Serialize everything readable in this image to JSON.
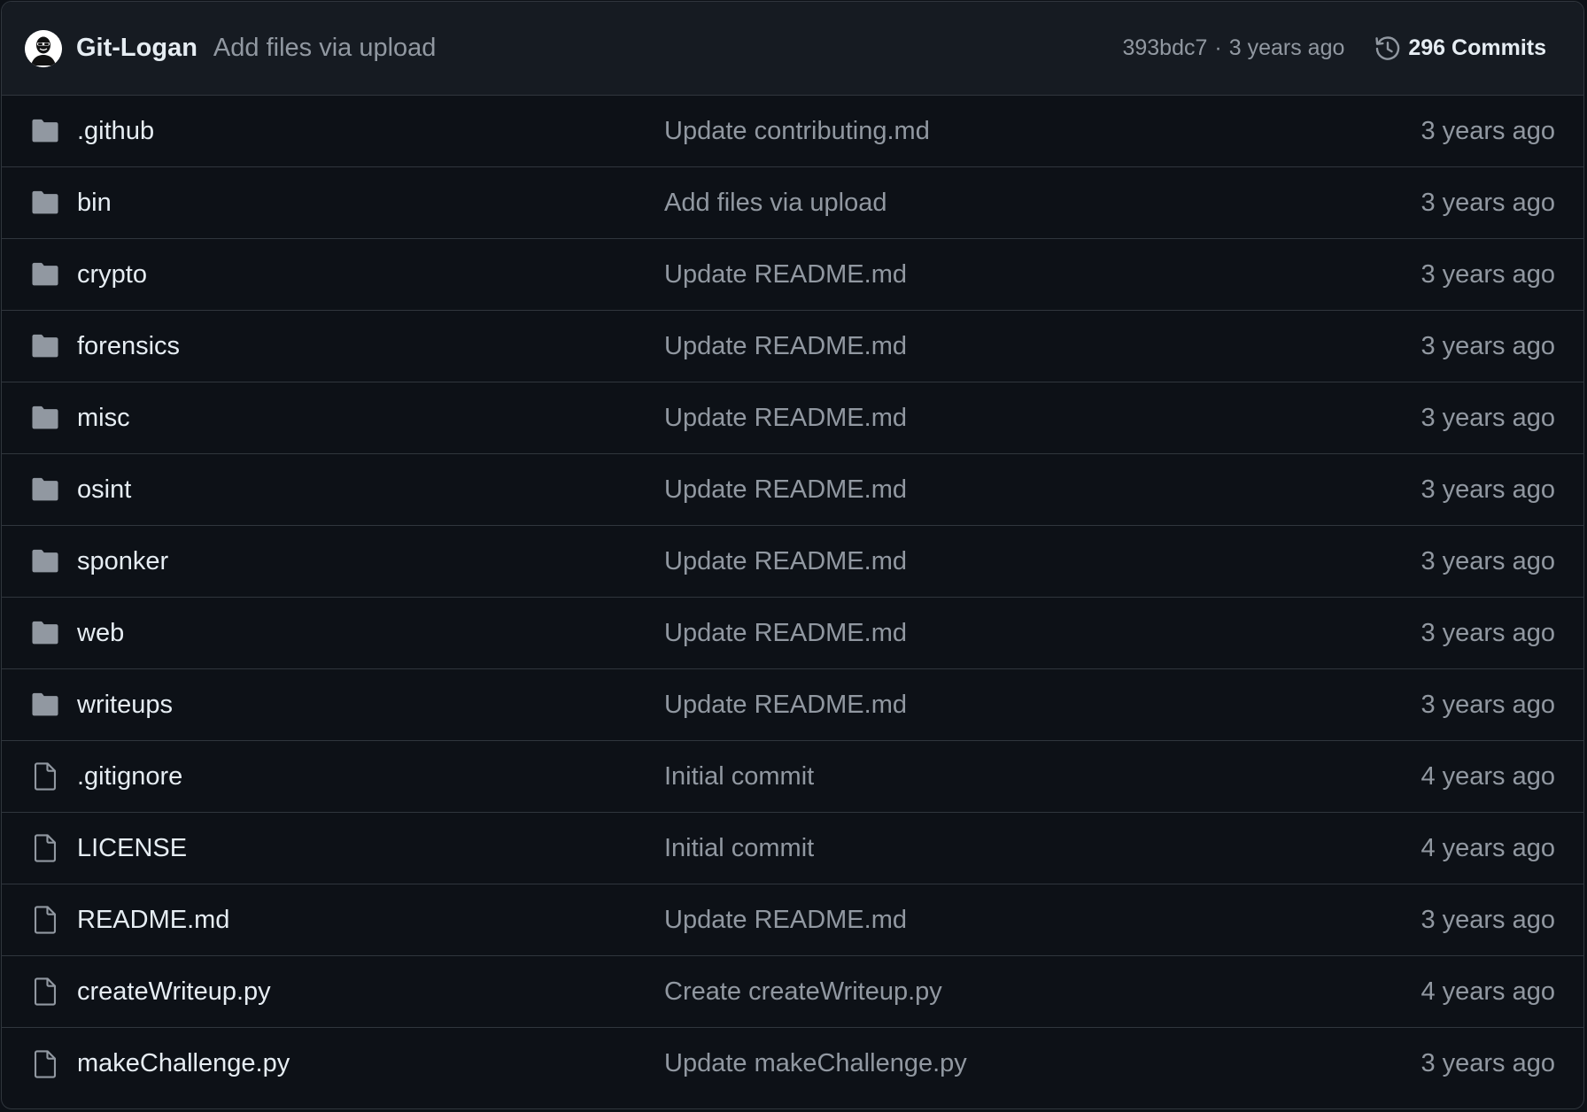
{
  "header": {
    "author": "Git-Logan",
    "commit_message": "Add files via upload",
    "sha": "393bdc7",
    "separator": "·",
    "time": "3 years ago",
    "commits_label": "296 Commits"
  },
  "colors": {
    "background": "#0d1117",
    "header_background": "#161b22",
    "border": "#30363d",
    "text_primary": "#e6edf3",
    "text_muted": "#9198a1",
    "icon": "#9198a1"
  },
  "entries": [
    {
      "type": "folder",
      "icon": "folder-icon",
      "name": ".github",
      "message": "Update contributing.md",
      "age": "3 years ago"
    },
    {
      "type": "folder",
      "icon": "folder-icon",
      "name": "bin",
      "message": "Add files via upload",
      "age": "3 years ago"
    },
    {
      "type": "folder",
      "icon": "folder-icon",
      "name": "crypto",
      "message": "Update README.md",
      "age": "3 years ago"
    },
    {
      "type": "folder",
      "icon": "folder-icon",
      "name": "forensics",
      "message": "Update README.md",
      "age": "3 years ago"
    },
    {
      "type": "folder",
      "icon": "folder-icon",
      "name": "misc",
      "message": "Update README.md",
      "age": "3 years ago"
    },
    {
      "type": "folder",
      "icon": "folder-icon",
      "name": "osint",
      "message": "Update README.md",
      "age": "3 years ago"
    },
    {
      "type": "folder",
      "icon": "folder-icon",
      "name": "sponker",
      "message": "Update README.md",
      "age": "3 years ago"
    },
    {
      "type": "folder",
      "icon": "folder-icon",
      "name": "web",
      "message": "Update README.md",
      "age": "3 years ago"
    },
    {
      "type": "folder",
      "icon": "folder-icon",
      "name": "writeups",
      "message": "Update README.md",
      "age": "3 years ago"
    },
    {
      "type": "file",
      "icon": "file-icon",
      "name": ".gitignore",
      "message": "Initial commit",
      "age": "4 years ago"
    },
    {
      "type": "file",
      "icon": "file-icon",
      "name": "LICENSE",
      "message": "Initial commit",
      "age": "4 years ago"
    },
    {
      "type": "file",
      "icon": "file-icon",
      "name": "README.md",
      "message": "Update README.md",
      "age": "3 years ago"
    },
    {
      "type": "file",
      "icon": "file-icon",
      "name": "createWriteup.py",
      "message": "Create createWriteup.py",
      "age": "4 years ago"
    },
    {
      "type": "file",
      "icon": "file-icon",
      "name": "makeChallenge.py",
      "message": "Update makeChallenge.py",
      "age": "3 years ago"
    }
  ]
}
